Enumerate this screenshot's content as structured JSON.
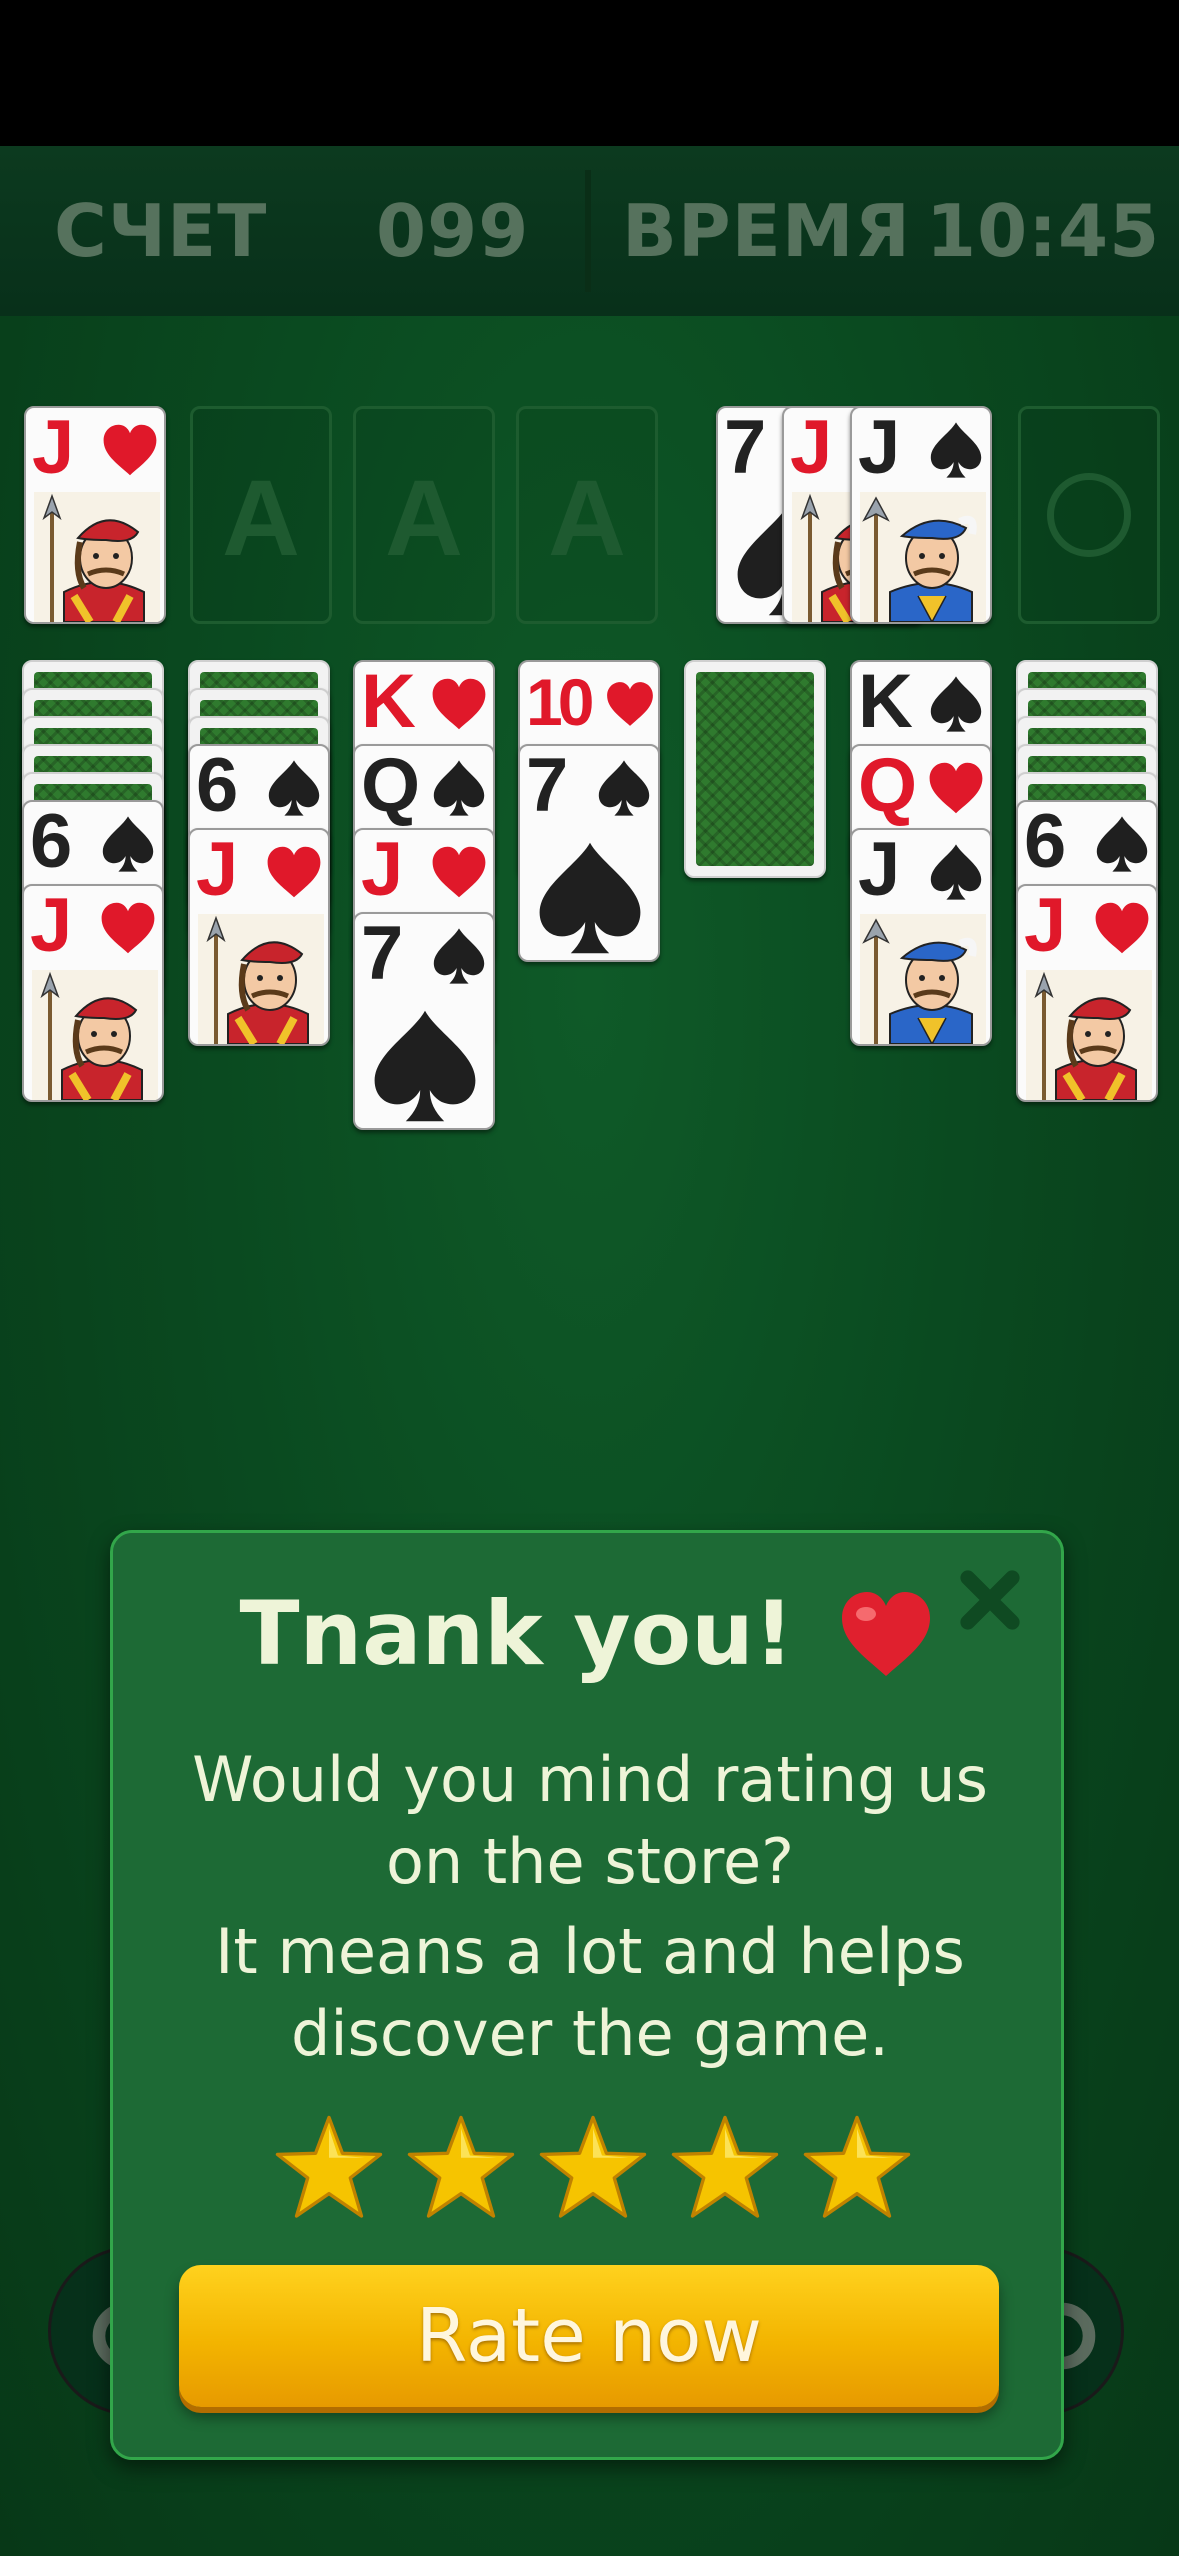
{
  "hud": {
    "score_label": "СЧЕТ",
    "score_value": "099",
    "time_label": "ВРЕМЯ",
    "time_value": "10:45"
  },
  "foundation": {
    "left_card": {
      "rank": "J",
      "suit": "hearts"
    },
    "empty_slot_label": "A",
    "waste": [
      {
        "rank": "7",
        "suit": "spades"
      },
      {
        "rank": "J",
        "suit": "hearts"
      },
      {
        "rank": "J",
        "suit": "spades"
      }
    ]
  },
  "tableau": [
    {
      "hidden": 5,
      "cards": [
        {
          "rank": "6",
          "suit": "spades"
        },
        {
          "rank": "J",
          "suit": "hearts"
        }
      ]
    },
    {
      "hidden": 3,
      "cards": [
        {
          "rank": "6",
          "suit": "spades"
        },
        {
          "rank": "J",
          "suit": "hearts"
        }
      ]
    },
    {
      "hidden": 0,
      "cards": [
        {
          "rank": "K",
          "suit": "hearts"
        },
        {
          "rank": "Q",
          "suit": "spades"
        },
        {
          "rank": "J",
          "suit": "hearts"
        },
        {
          "rank": "7",
          "suit": "spades"
        }
      ]
    },
    {
      "hidden": 0,
      "cards": [
        {
          "rank": "10",
          "suit": "hearts"
        },
        {
          "rank": "7",
          "suit": "spades"
        }
      ]
    },
    {
      "hidden": 1,
      "cards": []
    },
    {
      "hidden": 0,
      "cards": [
        {
          "rank": "K",
          "suit": "spades"
        },
        {
          "rank": "Q",
          "suit": "hearts"
        },
        {
          "rank": "J",
          "suit": "spades"
        }
      ]
    },
    {
      "hidden": 5,
      "cards": [
        {
          "rank": "6",
          "suit": "spades"
        },
        {
          "rank": "J",
          "suit": "hearts"
        }
      ]
    }
  ],
  "popup": {
    "title": "Tnank you!",
    "line1": "Would you mind rating us",
    "line2": "on the store?",
    "line3": "It means a lot and helps",
    "line4": "discover the game.",
    "stars": 5,
    "button_label": "Rate now"
  },
  "icons": {
    "heart": "heart-icon",
    "close": "close-icon",
    "star": "star-icon",
    "settings": "gear-icon"
  },
  "colors": {
    "table": "#0a4a20",
    "popup_bg": "#1d6a35",
    "popup_border": "#32a64a",
    "button": "#f3b400",
    "hud_text": "#56725d",
    "red_suit": "#e0182a"
  }
}
